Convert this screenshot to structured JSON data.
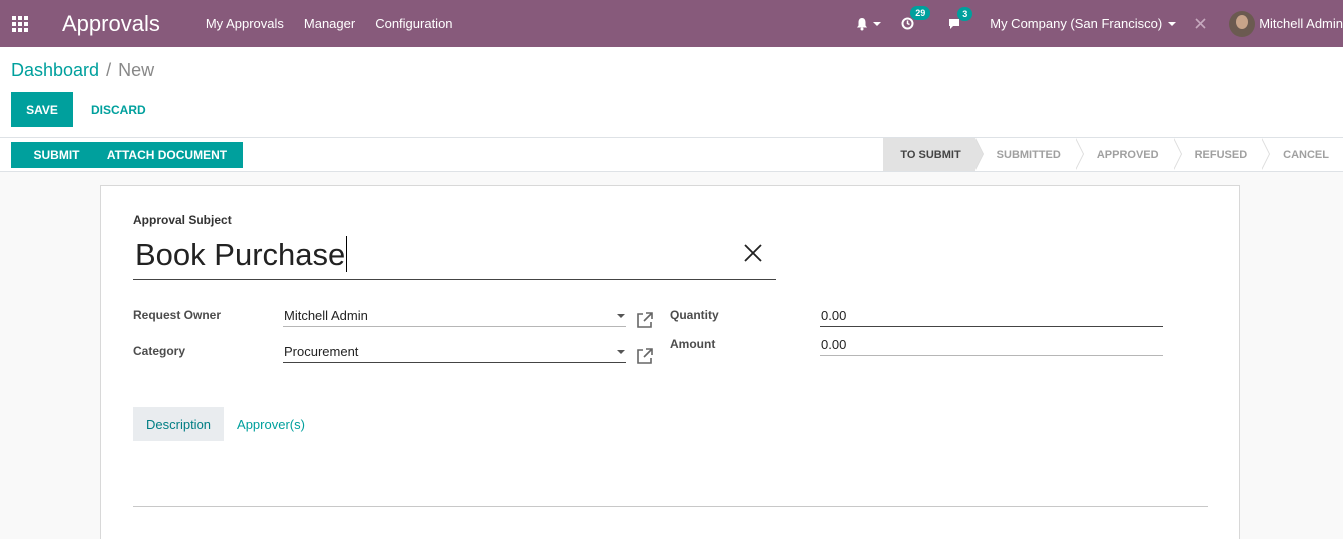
{
  "navbar": {
    "app_title": "Approvals",
    "menu": [
      "My Approvals",
      "Manager",
      "Configuration"
    ],
    "activity_badge": "29",
    "messages_badge": "3",
    "company": "My Company (San Francisco)",
    "user_name": "Mitchell Admin",
    "bg_color": "#875a7b"
  },
  "breadcrumb": {
    "parent": "Dashboard",
    "separator": "/",
    "current": "New"
  },
  "buttons": {
    "save": "SAVE",
    "discard": "DISCARD",
    "submit": "SUBMIT",
    "attach_document": "ATTACH DOCUMENT"
  },
  "stages": [
    "TO SUBMIT",
    "SUBMITTED",
    "APPROVED",
    "REFUSED",
    "CANCEL"
  ],
  "form": {
    "subject_label": "Approval Subject",
    "subject_value": "Book Purchase",
    "request_owner_label": "Request Owner",
    "request_owner_value": "Mitchell Admin",
    "category_label": "Category",
    "category_value": "Procurement",
    "quantity_label": "Quantity",
    "quantity_value": "0.00",
    "amount_label": "Amount",
    "amount_value": "0.00"
  },
  "tabs": [
    "Description",
    "Approver(s)"
  ],
  "colors": {
    "accent": "#00a09d",
    "brand": "#875a7b"
  }
}
